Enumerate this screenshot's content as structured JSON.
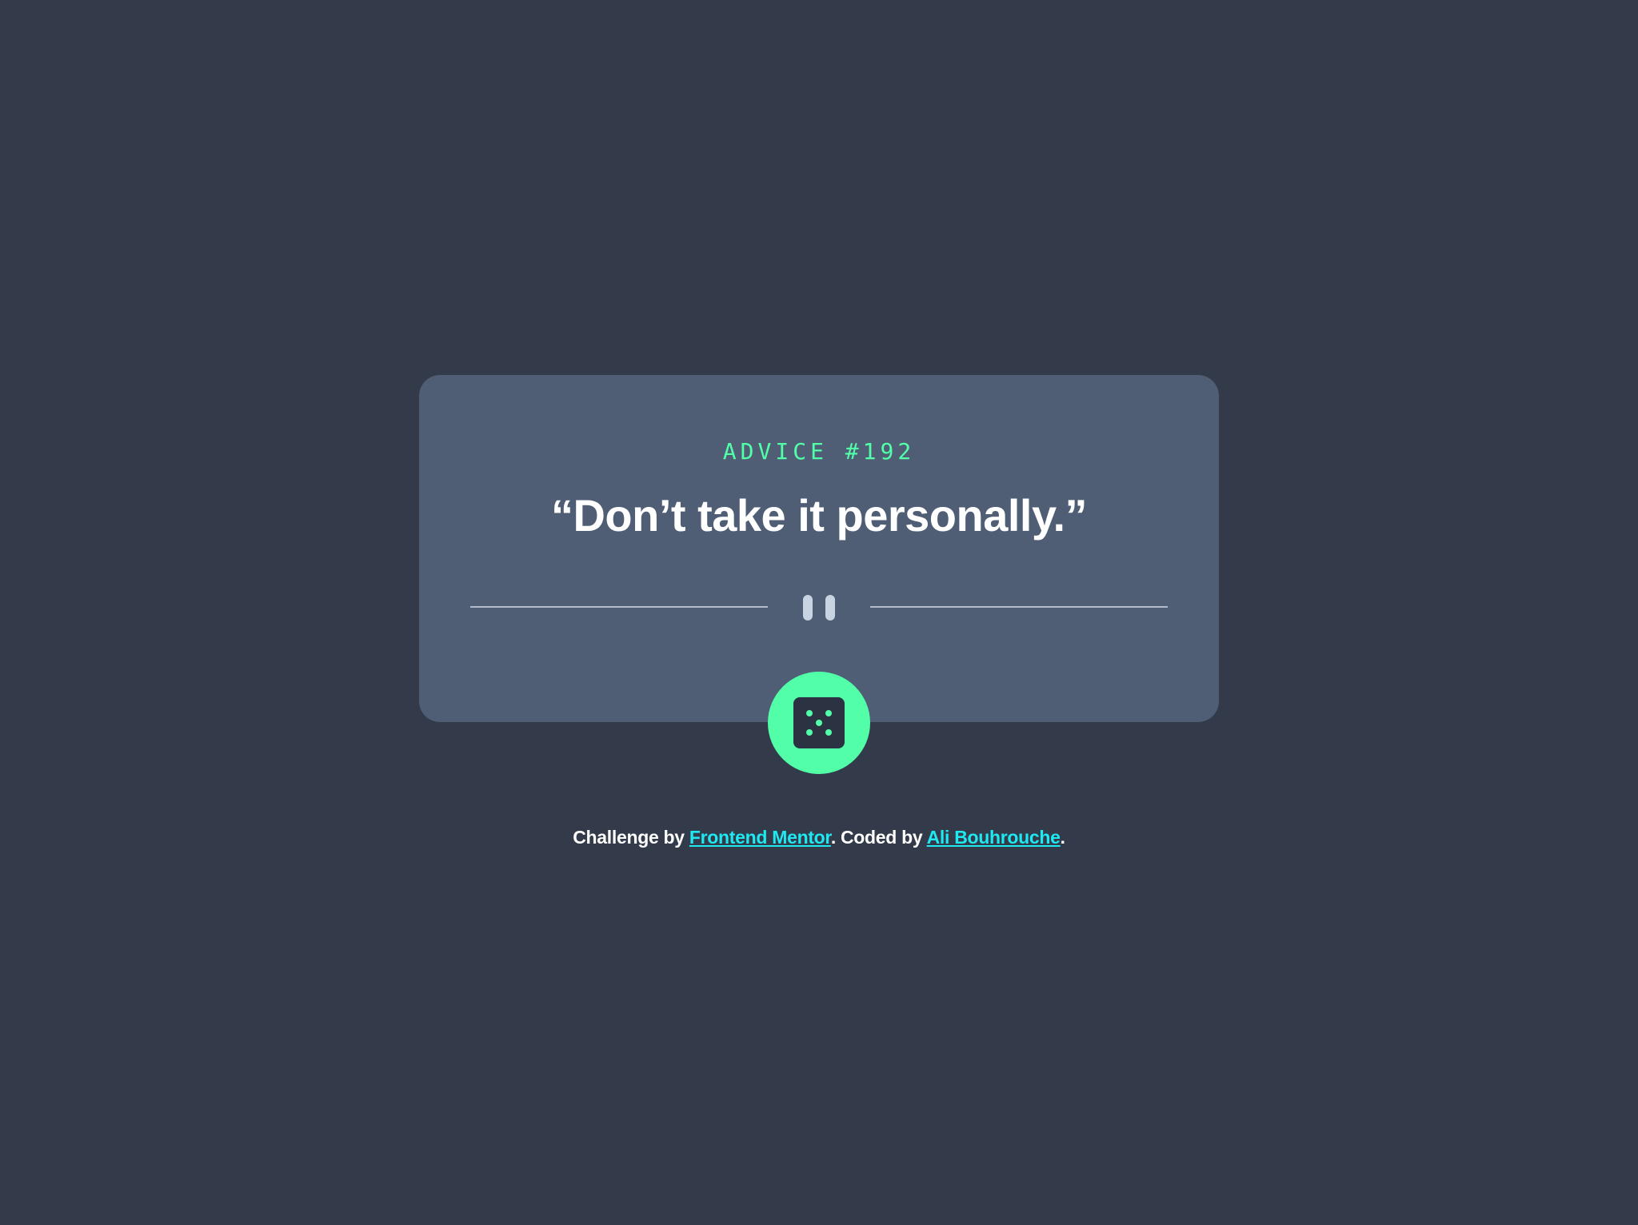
{
  "advice": {
    "id_label": "ADVICE #192",
    "quote": "“Don’t take it personally.”"
  },
  "divider": {
    "icon": "pause-icon"
  },
  "dice_button": {
    "icon": "dice-icon"
  },
  "footer": {
    "prefix": "Challenge by ",
    "challenge_link": "Frontend Mentor",
    "middle": ". Coded by ",
    "author_link": "Ali Bouhrouche",
    "suffix": "."
  },
  "colors": {
    "background": "#333a4a",
    "card": "#4f5d75",
    "accent": "#52ffa8",
    "link": "#1ee8f0",
    "text": "#ffffff"
  }
}
